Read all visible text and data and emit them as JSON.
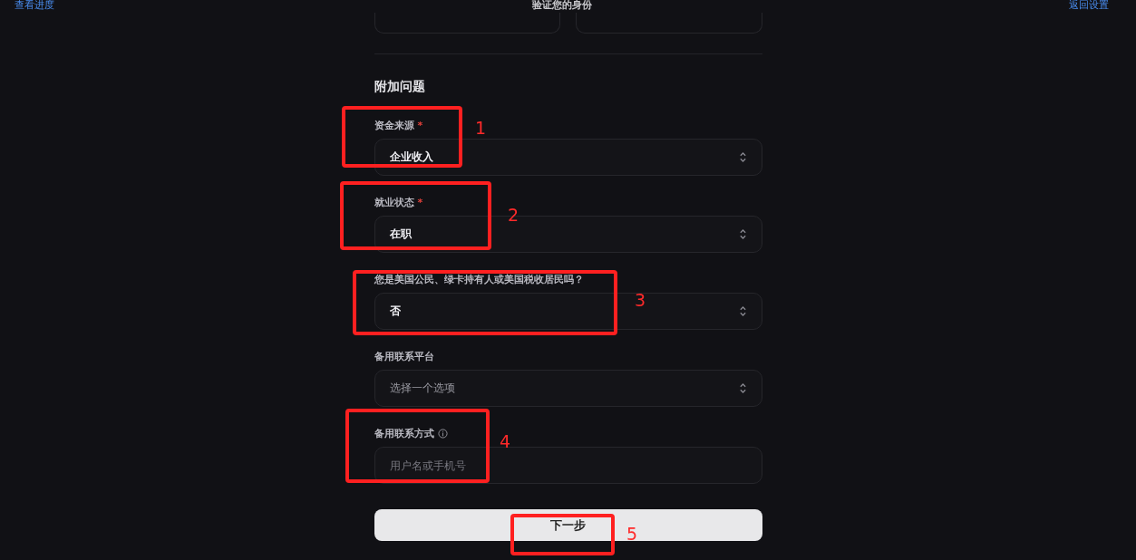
{
  "header": {
    "left_link": "查看进度",
    "title": "验证您的身份",
    "right_link": "返回设置"
  },
  "section_title": "附加问题",
  "fields": [
    {
      "label": "资金来源",
      "required_mark": "*",
      "kind": "select",
      "value": "企业收入"
    },
    {
      "label": "就业状态",
      "required_mark": "*",
      "kind": "select",
      "value": "在职"
    },
    {
      "label": "您是美国公民、绿卡持有人或美国税收居民吗？",
      "kind": "select",
      "value": "否"
    },
    {
      "label": "备用联系平台",
      "kind": "select",
      "placeholder": "选择一个选项"
    },
    {
      "label": "备用联系方式",
      "kind": "text",
      "info": true,
      "placeholder": "用户名或手机号"
    }
  ],
  "submit": "下一步",
  "annotations": [
    {
      "number": "1"
    },
    {
      "number": "2"
    },
    {
      "number": "3"
    },
    {
      "number": "4"
    },
    {
      "number": "5"
    }
  ]
}
